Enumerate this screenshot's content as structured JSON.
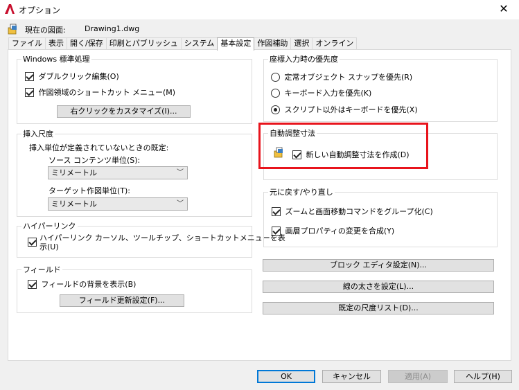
{
  "window": {
    "title": "オプション"
  },
  "header": {
    "current_drawing_label": "現在の図面:",
    "drawing_name": "Drawing1.dwg"
  },
  "tabs": [
    {
      "label": "ファイル"
    },
    {
      "label": "表示"
    },
    {
      "label": "開く/保存"
    },
    {
      "label": "印刷とパブリッシュ"
    },
    {
      "label": "システム"
    },
    {
      "label": "基本設定",
      "active": true
    },
    {
      "label": "作図補助"
    },
    {
      "label": "選択"
    },
    {
      "label": "オンライン"
    }
  ],
  "windows_std": {
    "legend": "Windows 標準処理",
    "double_click": {
      "label": "ダブルクリック編集(O)",
      "checked": true
    },
    "shortcut_menu": {
      "label": "作図領域のショートカット メニュー(M)",
      "checked": true
    },
    "customize_button": "右クリックをカスタマイズ(I)..."
  },
  "insert_scale": {
    "legend": "挿入尺度",
    "desc": "挿入単位が定義されていないときの既定:",
    "source_label": "ソース コンテンツ単位(S):",
    "source_value": "ミリメートル",
    "target_label": "ターゲット作図単位(T):",
    "target_value": "ミリメートル"
  },
  "hyperlink": {
    "legend": "ハイパーリンク",
    "checkbox_line1": "ハイパーリンク カーソル、ツールチップ、ショートカットメニューを表",
    "checkbox_line2": "示(U)",
    "checked": true
  },
  "field": {
    "legend": "フィールド",
    "show_bg": {
      "label": "フィールドの背景を表示(B)",
      "checked": true
    },
    "update_button": "フィールド更新設定(F)..."
  },
  "coord_priority": {
    "legend": "座標入力時の優先度",
    "options": [
      {
        "label": "定常オブジェクト スナップを優先(R)",
        "checked": false
      },
      {
        "label": "キーボード入力を優先(K)",
        "checked": false
      },
      {
        "label": "スクリプト以外はキーボードを優先(X)",
        "checked": true
      }
    ]
  },
  "assoc_dim": {
    "legend": "自動調整寸法",
    "checkbox": {
      "label": "新しい自動調整寸法を作成(D)",
      "checked": true
    }
  },
  "undo_redo": {
    "legend": "元に戻す/やり直し",
    "zoom_pan": {
      "label": "ズームと画面移動コマンドをグループ化(C)",
      "checked": true
    },
    "layer_props": {
      "label": "画層プロパティの変更を合成(Y)",
      "checked": true
    }
  },
  "right_buttons": {
    "block_editor": "ブロック エディタ設定(N)...",
    "lineweight": "線の太さを設定(L)...",
    "scale_list": "既定の尺度リスト(D)..."
  },
  "footer": {
    "ok": "OK",
    "cancel": "キャンセル",
    "apply": "適用(A)",
    "help": "ヘルプ(H)"
  },
  "colors": {
    "highlight": "#e8141c",
    "default_button_border": "#0078d7",
    "app_icon": "#c8102e"
  }
}
